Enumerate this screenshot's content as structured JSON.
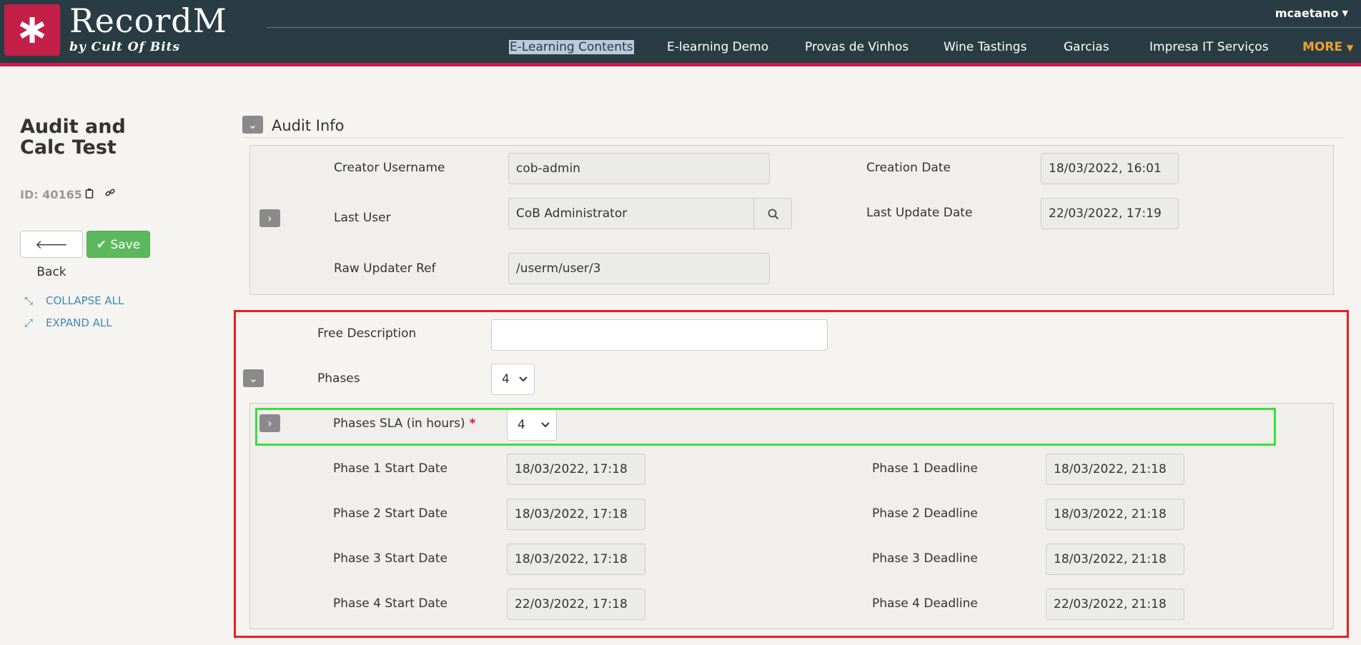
{
  "header": {
    "brand": "RecordM",
    "brand_sub": "by Cult Of Bits",
    "user": "mcaetano",
    "nav": [
      {
        "label": "E-Learning Contents",
        "selected": true
      },
      {
        "label": "E-learning Demo"
      },
      {
        "label": "Provas de Vinhos"
      },
      {
        "label": "Wine Tastings"
      },
      {
        "label": "Garcias"
      },
      {
        "label": "Impresa IT Serviços"
      },
      {
        "label": "MORE"
      }
    ]
  },
  "sidebar": {
    "title": "Audit and Calc Test",
    "record_id": "ID: 40165",
    "back_label": "Back",
    "save_label": "Save",
    "collapse_all": "COLLAPSE ALL",
    "expand_all": "EXPAND ALL"
  },
  "audit": {
    "title": "Audit Info",
    "creator_username_label": "Creator Username",
    "creator_username": "cob-admin",
    "creation_date_label": "Creation Date",
    "creation_date": "18/03/2022, 16:01",
    "last_user_label": "Last User",
    "last_user": "CoB Administrator",
    "last_update_label": "Last Update Date",
    "last_update": "22/03/2022, 17:19",
    "raw_updater_label": "Raw Updater Ref",
    "raw_updater": "/userm/user/3"
  },
  "form": {
    "free_description_label": "Free Description",
    "free_description": "",
    "phases_label": "Phases",
    "phases_value": "4",
    "phases_sla_label": "Phases SLA (in hours)",
    "phases_sla_required": "*",
    "phases_sla_value": "4",
    "phases": [
      {
        "start_label": "Phase 1 Start Date",
        "start": "18/03/2022, 17:18",
        "deadline_label": "Phase 1 Deadline",
        "deadline": "18/03/2022, 21:18"
      },
      {
        "start_label": "Phase 2 Start Date",
        "start": "18/03/2022, 17:18",
        "deadline_label": "Phase 2 Deadline",
        "deadline": "18/03/2022, 21:18"
      },
      {
        "start_label": "Phase 3 Start Date",
        "start": "18/03/2022, 17:18",
        "deadline_label": "Phase 3 Deadline",
        "deadline": "18/03/2022, 21:18"
      },
      {
        "start_label": "Phase 4 Start Date",
        "start": "22/03/2022, 17:18",
        "deadline_label": "Phase 4 Deadline",
        "deadline": "22/03/2022, 21:18"
      }
    ]
  },
  "colors": {
    "header_bg": "#2a3c43",
    "accent": "#c41f49",
    "save_green": "#5cb85c",
    "link_blue": "#3b8ab8",
    "more_orange": "#f0a030",
    "highlight_red": "#ee1c1c",
    "highlight_green": "#3ddc3d"
  }
}
